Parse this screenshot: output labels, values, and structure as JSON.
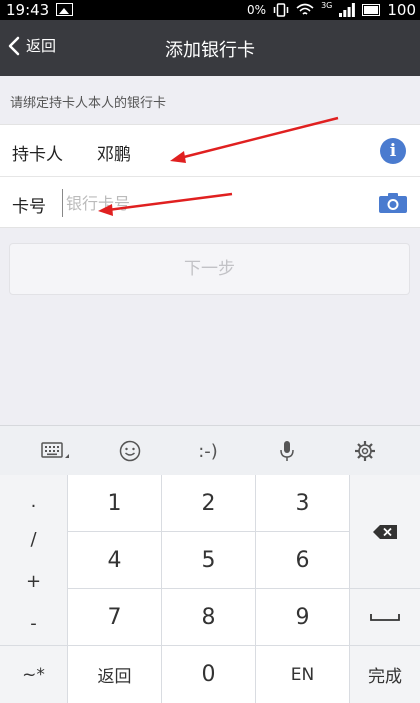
{
  "status_bar": {
    "time": "19:43",
    "battery_pct_label": "0%",
    "network_label": "3G",
    "battery_level": "100"
  },
  "nav": {
    "back_label": "返回",
    "title": "添加银行卡"
  },
  "hint_text": "请绑定持卡人本人的银行卡",
  "form": {
    "cardholder_label": "持卡人",
    "cardholder_value": "邓鹏",
    "card_number_label": "卡号",
    "card_number_placeholder": "银行卡号",
    "card_number_value": ""
  },
  "next_button_label": "下一步",
  "keyboard": {
    "toolbar": {
      "keyboard_icon": "keyboard-icon",
      "emoji_icon": "emoji-icon",
      "emoticon_text": ":-)",
      "mic_icon": "microphone-icon",
      "settings_icon": "gear-icon"
    },
    "symbols": [
      ".",
      "/",
      "+",
      "-"
    ],
    "digits": [
      "1",
      "2",
      "3",
      "4",
      "5",
      "6",
      "7",
      "8",
      "9",
      "0"
    ],
    "bottom_left": "~*",
    "back_key": "返回",
    "en_key": "EN",
    "done_key": "完成"
  },
  "colors": {
    "navbar": "#393a3f",
    "accent": "#4a7bcf",
    "annotation_arrow": "#e02020"
  }
}
